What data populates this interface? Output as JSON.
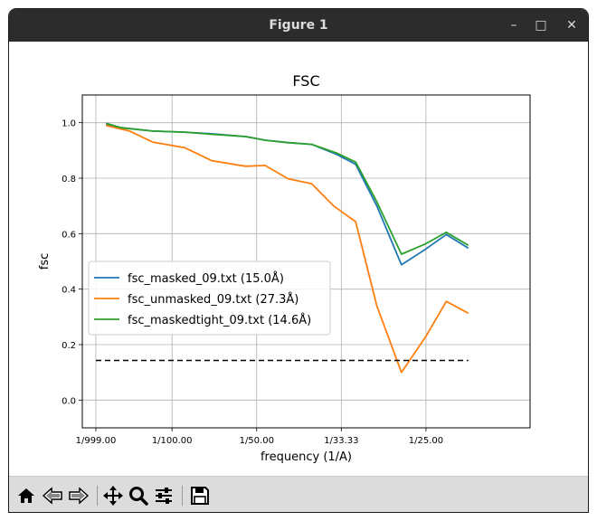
{
  "window": {
    "title": "Figure 1",
    "minimize_glyph": "–",
    "maximize_glyph": "□",
    "close_glyph": "✕"
  },
  "toolbar": {
    "buttons": [
      "home-icon",
      "back-icon",
      "forward-icon",
      "pan-icon",
      "zoom-icon",
      "configure-subplots-icon",
      "save-icon"
    ]
  },
  "chart_data": {
    "type": "line",
    "title": "FSC",
    "xlabel": "frequency (1/A)",
    "ylabel": "fsc",
    "xlim": [
      -0.0006,
      0.0523
    ],
    "ylim": [
      -0.1,
      1.1
    ],
    "xticks": [
      {
        "value": 0.001,
        "label": "1/999.00"
      },
      {
        "value": 0.01,
        "label": "1/100.00"
      },
      {
        "value": 0.02,
        "label": "1/50.00"
      },
      {
        "value": 0.03,
        "label": "1/33.33"
      },
      {
        "value": 0.04,
        "label": "1/25.00"
      }
    ],
    "yticks": [
      {
        "value": 0.0,
        "label": "0.0"
      },
      {
        "value": 0.2,
        "label": "0.2"
      },
      {
        "value": 0.4,
        "label": "0.4"
      },
      {
        "value": 0.6,
        "label": "0.6"
      },
      {
        "value": 0.8,
        "label": "0.8"
      },
      {
        "value": 1.0,
        "label": "1.0"
      }
    ],
    "grid": true,
    "legend_position": "center-left",
    "series": [
      {
        "name": "fsc_masked_09.txt (15.0Å)",
        "color": "#1f77b4",
        "style": "solid",
        "points": [
          [
            0.0022,
            0.995
          ],
          [
            0.004,
            0.982
          ],
          [
            0.0077,
            0.97
          ],
          [
            0.0115,
            0.966
          ],
          [
            0.0147,
            0.96
          ],
          [
            0.0187,
            0.95
          ],
          [
            0.021,
            0.937
          ],
          [
            0.0237,
            0.928
          ],
          [
            0.0265,
            0.922
          ],
          [
            0.0295,
            0.885
          ],
          [
            0.0317,
            0.85
          ],
          [
            0.0342,
            0.7
          ],
          [
            0.0371,
            0.488
          ],
          [
            0.04,
            0.545
          ],
          [
            0.0424,
            0.597
          ],
          [
            0.045,
            0.548
          ]
        ]
      },
      {
        "name": "fsc_unmasked_09.txt (27.3Å)",
        "color": "#ff7f0e",
        "style": "solid",
        "points": [
          [
            0.0022,
            0.99
          ],
          [
            0.005,
            0.97
          ],
          [
            0.0077,
            0.93
          ],
          [
            0.0115,
            0.91
          ],
          [
            0.0147,
            0.863
          ],
          [
            0.0187,
            0.843
          ],
          [
            0.021,
            0.846
          ],
          [
            0.0237,
            0.798
          ],
          [
            0.0265,
            0.78
          ],
          [
            0.0291,
            0.7
          ],
          [
            0.0317,
            0.643
          ],
          [
            0.0342,
            0.34
          ],
          [
            0.0371,
            0.1
          ],
          [
            0.04,
            0.23
          ],
          [
            0.0424,
            0.356
          ],
          [
            0.045,
            0.313
          ]
        ]
      },
      {
        "name": "fsc_maskedtight_09.txt (14.6Å)",
        "color": "#2ca02c",
        "style": "solid",
        "points": [
          [
            0.0022,
            0.998
          ],
          [
            0.004,
            0.982
          ],
          [
            0.0077,
            0.97
          ],
          [
            0.0115,
            0.966
          ],
          [
            0.0147,
            0.958
          ],
          [
            0.0187,
            0.95
          ],
          [
            0.021,
            0.937
          ],
          [
            0.0237,
            0.928
          ],
          [
            0.0265,
            0.922
          ],
          [
            0.0295,
            0.89
          ],
          [
            0.0317,
            0.858
          ],
          [
            0.0342,
            0.715
          ],
          [
            0.0371,
            0.526
          ],
          [
            0.04,
            0.564
          ],
          [
            0.0424,
            0.605
          ],
          [
            0.045,
            0.558
          ]
        ]
      },
      {
        "name": "",
        "color": "#000000",
        "style": "dashed",
        "points": [
          [
            0.001,
            0.143
          ],
          [
            0.045,
            0.143
          ]
        ]
      }
    ]
  }
}
